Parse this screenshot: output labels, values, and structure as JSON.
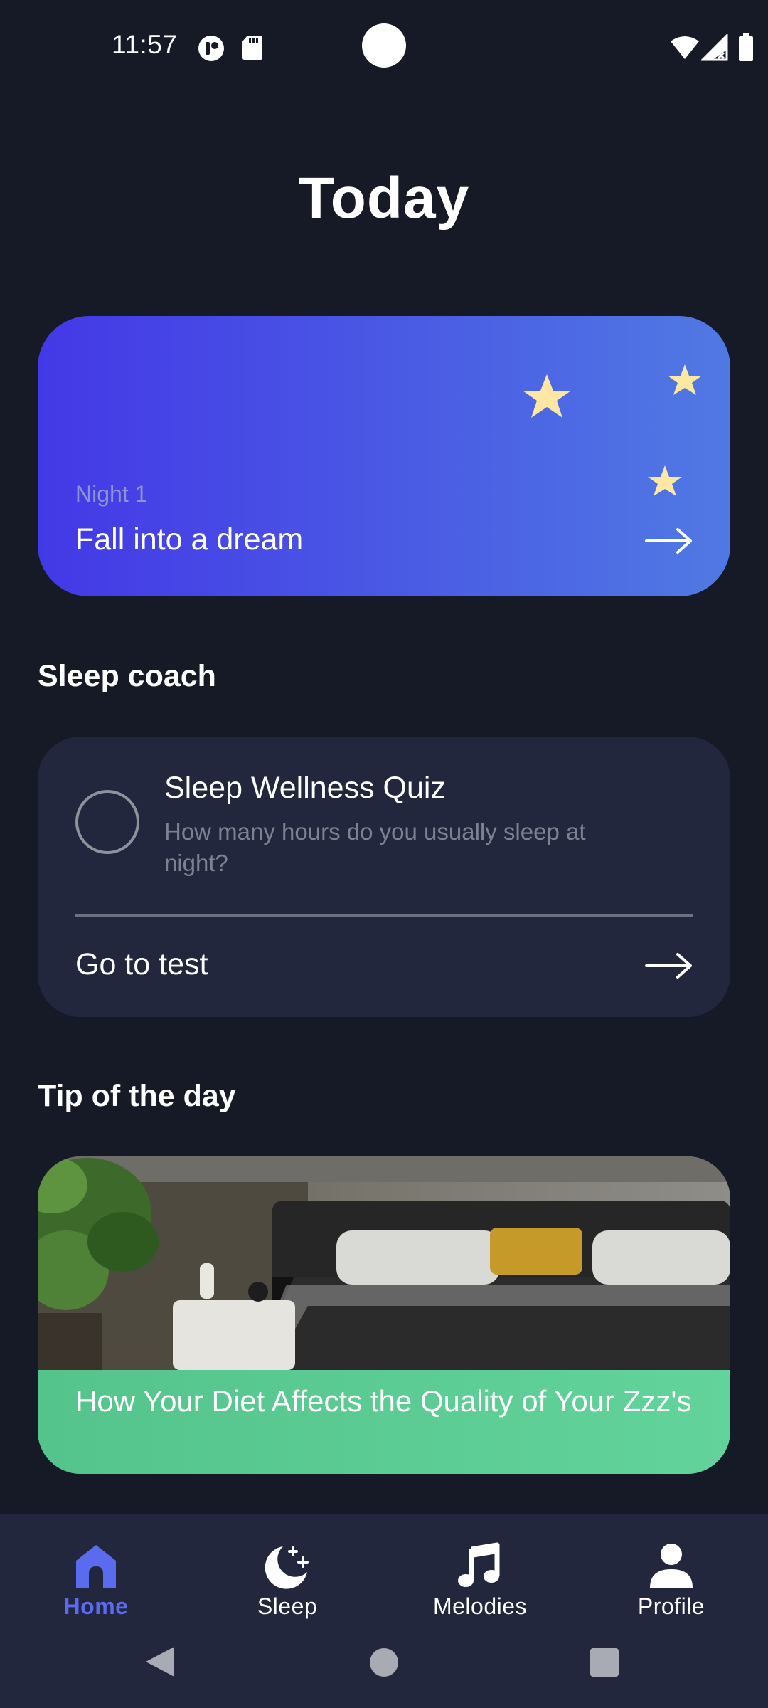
{
  "status_bar": {
    "time": "11:57",
    "icons": [
      "notification-app-icon",
      "sd-card-icon",
      "wifi-icon",
      "signal-icon",
      "battery-icon"
    ]
  },
  "page": {
    "title": "Today"
  },
  "hero_card": {
    "subtitle": "Night 1",
    "title": "Fall into a dream",
    "arrow_icon": "arrow-right-icon",
    "gradient_start": "#4338e6",
    "gradient_end": "#5079e3",
    "decoration_icon": "moon-and-stars-icon",
    "decoration_color": "#fde7a3"
  },
  "sleep_coach": {
    "heading": "Sleep coach",
    "quiz_title": "Sleep Wellness Quiz",
    "quiz_question": "How many hours do you usually sleep at night?",
    "action_label": "Go to test",
    "arrow_icon": "arrow-right-icon",
    "card_color": "#22273d"
  },
  "tip": {
    "heading": "Tip of the day",
    "caption": "How Your Diet Affects the Quality of Your Zzz's",
    "image_icon": "bedroom-photo",
    "caption_color": "#5bcb93"
  },
  "bottom_nav": {
    "items": [
      {
        "label": "Home",
        "icon": "home-icon",
        "active": true
      },
      {
        "label": "Sleep",
        "icon": "moon-sparkle-icon",
        "active": false
      },
      {
        "label": "Melodies",
        "icon": "music-note-icon",
        "active": false
      },
      {
        "label": "Profile",
        "icon": "person-icon",
        "active": false
      }
    ],
    "active_color": "#5b6bf0"
  },
  "system_nav": {
    "icons": [
      "back-icon",
      "home-circle-icon",
      "recents-icon"
    ]
  }
}
